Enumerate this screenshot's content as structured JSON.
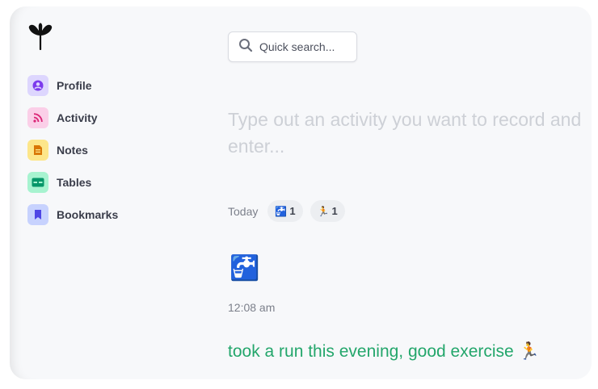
{
  "nav": {
    "items": [
      {
        "label": "Profile",
        "icon": "user-circle-icon",
        "bg": "#ddd6fe",
        "fg": "#7c3aed"
      },
      {
        "label": "Activity",
        "icon": "rss-icon",
        "bg": "#fbcfe8",
        "fg": "#db2777"
      },
      {
        "label": "Notes",
        "icon": "document-icon",
        "bg": "#fde68a",
        "fg": "#d97706"
      },
      {
        "label": "Tables",
        "icon": "table-icon",
        "bg": "#a7f3d0",
        "fg": "#059669"
      },
      {
        "label": "Bookmarks",
        "icon": "bookmark-icon",
        "bg": "#c7d2fe",
        "fg": "#4f46e5"
      }
    ]
  },
  "search": {
    "label": "Quick search..."
  },
  "composer": {
    "line1": "Type out an activity you want to record and",
    "line2": "enter..."
  },
  "timeline": {
    "day_label": "Today",
    "chips": [
      {
        "emoji": "🚰",
        "count": "1"
      },
      {
        "emoji": "🏃",
        "count": "1"
      }
    ]
  },
  "entries": [
    {
      "emoji": "🚰",
      "time": "12:08 am"
    },
    {
      "text": "took a run this evening, good exercise 🏃"
    }
  ],
  "colors": {
    "accent_green": "#23a66b",
    "background": "#f7f8fa"
  }
}
